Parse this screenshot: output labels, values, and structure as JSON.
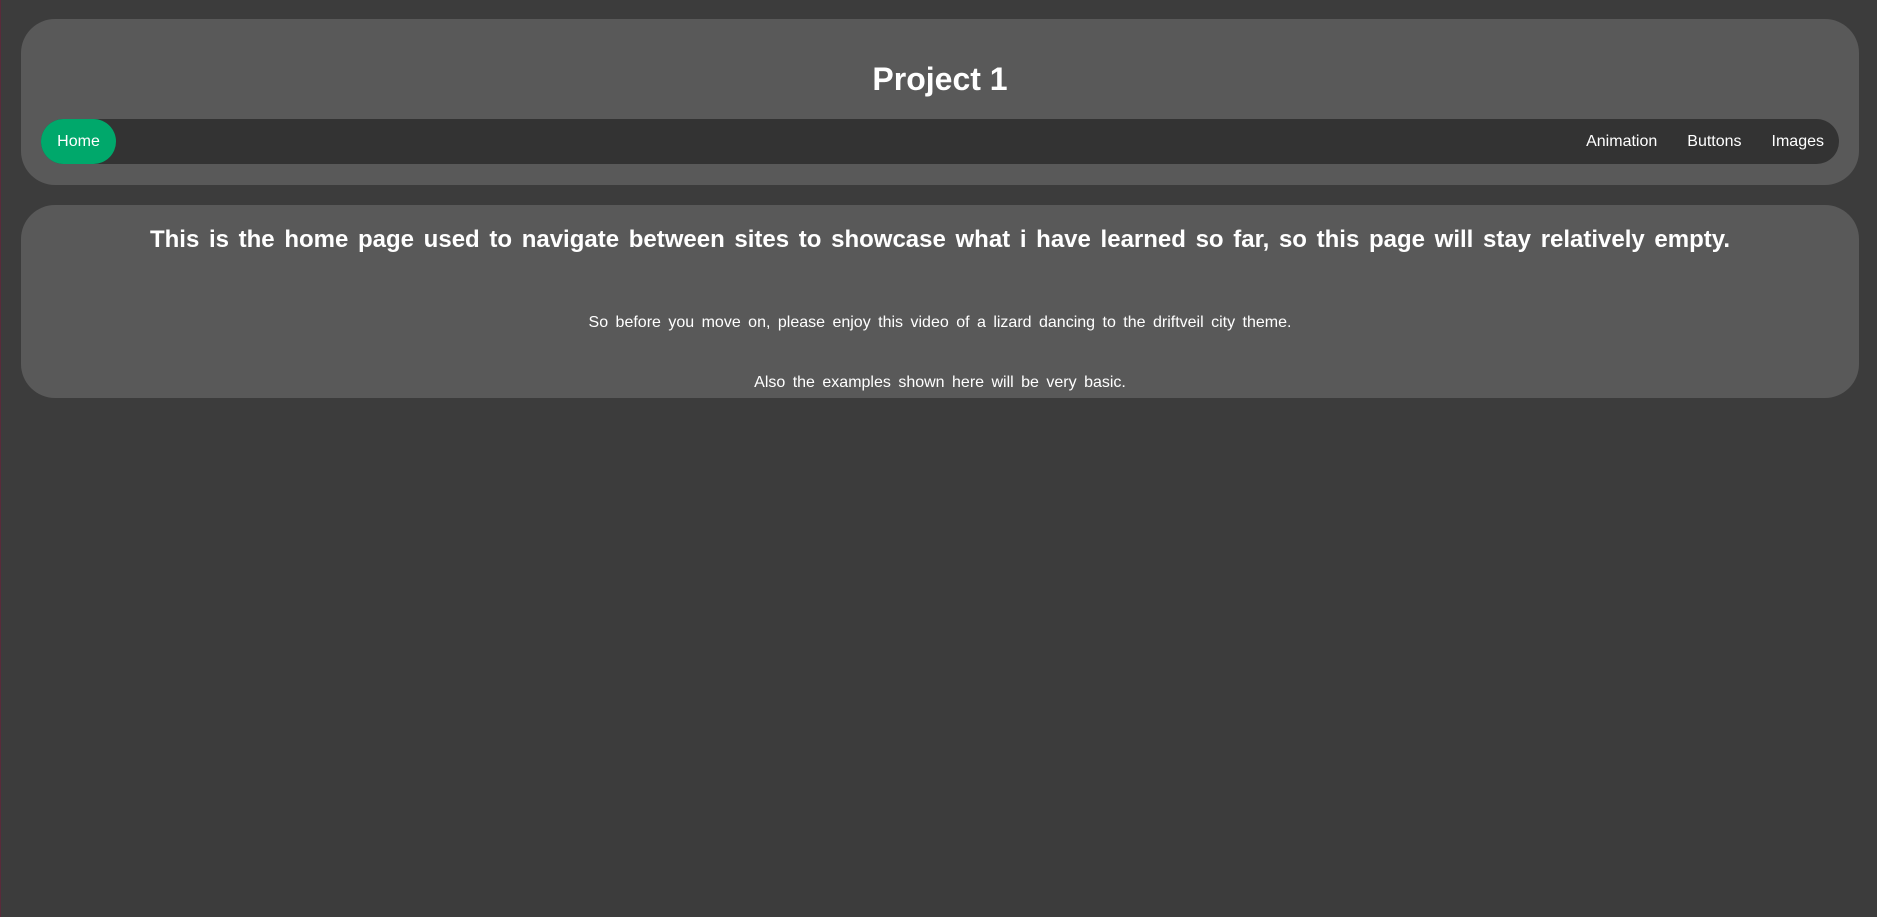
{
  "header": {
    "title": "Project 1"
  },
  "nav": {
    "home": "Home",
    "links": [
      "Animation",
      "Buttons",
      "Images"
    ]
  },
  "content": {
    "heading": "This is the home page used to navigate between sites to showcase what i have learned so far, so this page will stay relatively empty.",
    "paragraph_1": "So before you move on, please enjoy this video of a lizard dancing to the driftveil city theme.",
    "paragraph_2": "Also the examples shown here will be very basic."
  },
  "colors": {
    "page_background": "#3c3c3c",
    "card_background": "#595959",
    "navbar_background": "#333333",
    "active_accent": "#00a86b",
    "text": "#ffffff"
  }
}
